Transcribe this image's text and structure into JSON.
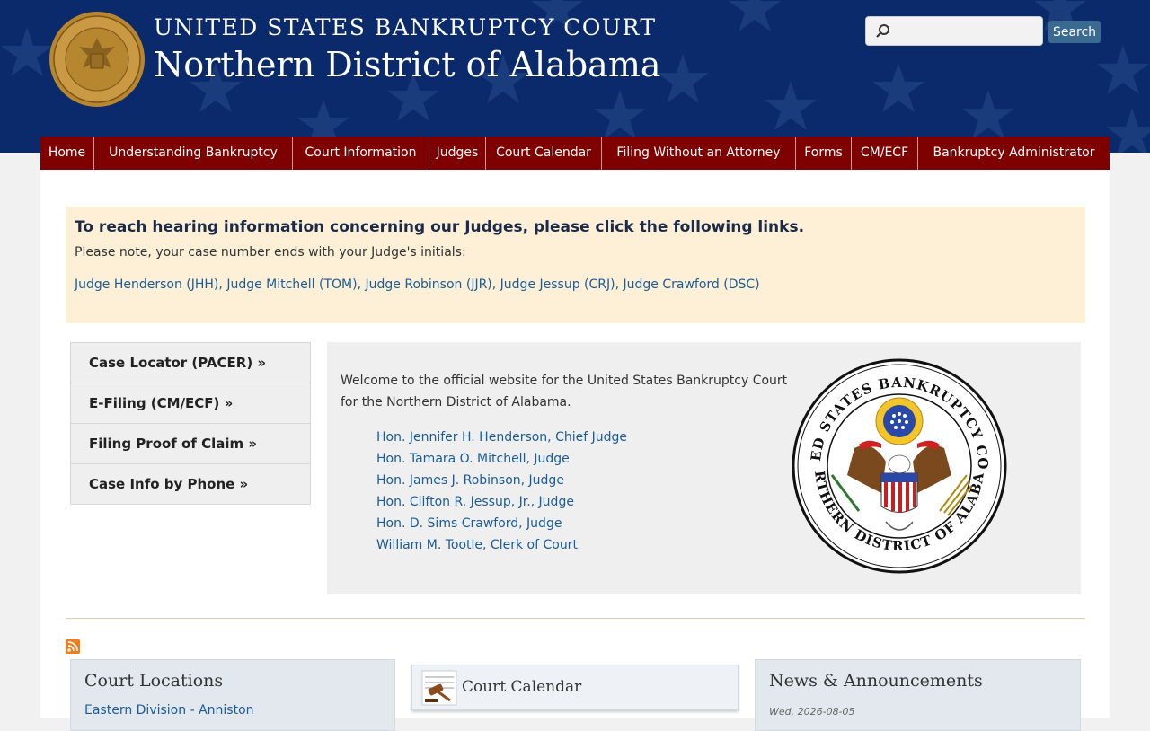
{
  "header": {
    "title_line1": "UNITED STATES BANKRUPTCY COURT",
    "title_line2": "Northern District of Alabama",
    "logo_icon": "court-seal-icon"
  },
  "search": {
    "placeholder": "",
    "value": "",
    "button_label": "Search",
    "icon": "search-icon"
  },
  "nav": {
    "items": [
      {
        "label": "Home"
      },
      {
        "label": "Understanding Bankruptcy"
      },
      {
        "label": "Court Information"
      },
      {
        "label": "Judges"
      },
      {
        "label": "Court Calendar"
      },
      {
        "label": "Filing Without an Attorney"
      },
      {
        "label": "Forms"
      },
      {
        "label": "CM/ECF"
      },
      {
        "label": "Bankruptcy Administrator"
      }
    ]
  },
  "notice": {
    "heading": "To reach hearing information concerning our Judges, please click the following links.",
    "note": "Please note, your case number ends with your Judge's initials:",
    "links": [
      {
        "label": "Judge Henderson (JHH)"
      },
      {
        "label": "Judge Mitchell (TOM)"
      },
      {
        "label": "Judge Robinson (JJR)"
      },
      {
        "label": "Judge Jessup (CRJ)"
      },
      {
        "label": "Judge Crawford (DSC)"
      }
    ],
    "separator": ", "
  },
  "quick_links": [
    {
      "label": "Case Locator (PACER) »"
    },
    {
      "label": "E-Filing (CM/ECF) »"
    },
    {
      "label": "Filing Proof of Claim »"
    },
    {
      "label": "Case Info by Phone »"
    }
  ],
  "welcome": {
    "text": "Welcome to the official website for the United States Bankruptcy Court for the Northern District of Alabama.",
    "officials": [
      "Hon. Jennifer H. Henderson, Chief Judge",
      "Hon. Tamara O. Mitchell, Judge",
      "Hon. James J. Robinson, Judge",
      "Hon. Clifton R. Jessup, Jr., Judge",
      "Hon. D. Sims Crawford, Judge",
      "William M. Tootle, Clerk of Court"
    ],
    "seal_text_top": "UNITED STATES BANKRUPTCY COURT",
    "seal_text_bottom": "NORTHERN DISTRICT OF ALABAMA"
  },
  "panels": {
    "locations": {
      "title": "Court Locations",
      "first_item": "Eastern Division - Anniston"
    },
    "calendar": {
      "title": "Court Calendar"
    },
    "news": {
      "title": "News & Announcements",
      "date": "Wed, 2026-08-05"
    }
  },
  "colors": {
    "header_bg": "#0b2a6b",
    "nav_bg": "#7f0000",
    "link": "#1a5c9a",
    "notice_bg": "#fdf0d6"
  }
}
